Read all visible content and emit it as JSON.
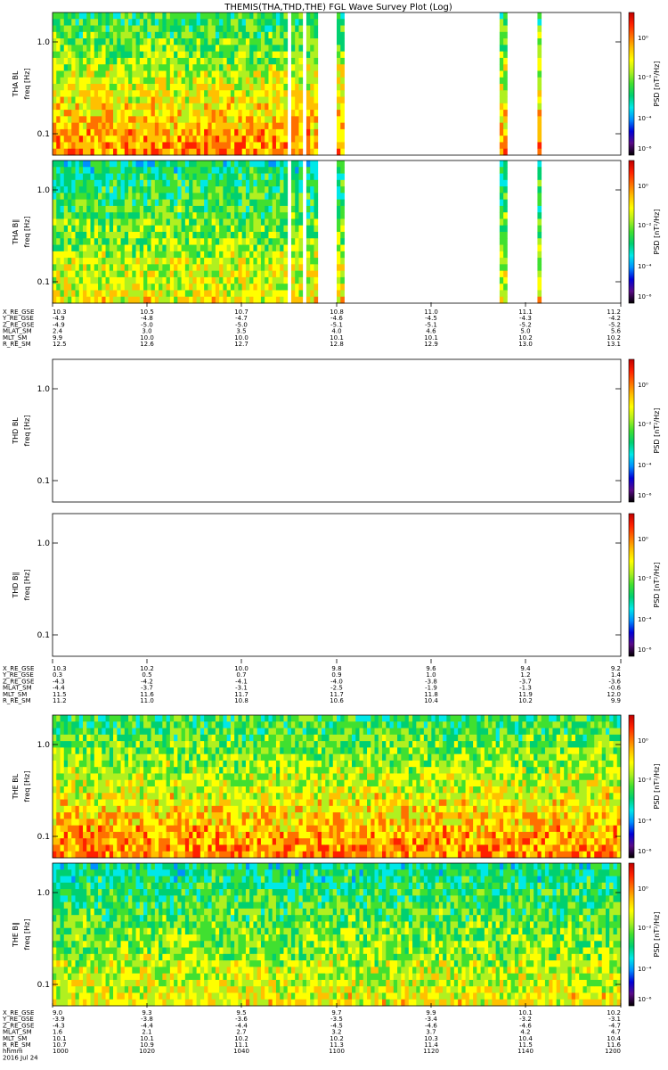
{
  "title": "THEMIS(THA,THD,THE) FGL Wave Survey Plot (Log)",
  "colors": {
    "colorbar_stops": [
      "#000000",
      "#5a0a86",
      "#0000d8",
      "#0090ff",
      "#00e8e8",
      "#00d070",
      "#40e030",
      "#b0f020",
      "#ffff00",
      "#ffc000",
      "#ff7000",
      "#ff2000",
      "#c00000"
    ]
  },
  "chart_data": [
    {
      "type": "heatmap",
      "probe": "THA",
      "component": "BL",
      "ylabel_line1": "THA BL",
      "ylabel_line2": "freq [Hz]",
      "cbar_label": "PSD [nT²/Hz]",
      "y_ticks": [
        "1.0",
        "0.1"
      ],
      "y_scale": "log",
      "cbar_ticks": [
        "10⁰",
        "10⁻²",
        "10⁻⁴",
        "10⁻⁶"
      ],
      "data_segments": [
        [
          0,
          0.387
        ],
        [
          0.399,
          0.413
        ],
        [
          0.42,
          0.435
        ],
        [
          0.452,
          0.459
        ],
        [
          0.46,
          0.465
        ],
        [
          0.503,
          0.507
        ],
        [
          0.79,
          0.795
        ],
        [
          0.857,
          0.86
        ],
        [
          1.02,
          1.022
        ],
        [
          1.034,
          1.04
        ],
        [
          1.077,
          1.08
        ],
        [
          1.116,
          1.125
        ],
        [
          1.128,
          1.133
        ],
        [
          1.143,
          1.147
        ]
      ],
      "level_profile": "high"
    },
    {
      "type": "heatmap",
      "probe": "THA",
      "component": "B∥",
      "ylabel_line1": "THA B∥",
      "ylabel_line2": "freq [Hz]",
      "cbar_label": "PSD [nT²/Hz]",
      "y_ticks": [
        "1.0",
        "0.1"
      ],
      "y_scale": "log",
      "cbar_ticks": [
        "10⁰",
        "10⁻²",
        "10⁻⁴",
        "10⁻⁶"
      ],
      "data_segments": [
        [
          0,
          0.387
        ],
        [
          0.399,
          0.413
        ],
        [
          0.42,
          0.435
        ],
        [
          0.452,
          0.459
        ],
        [
          0.46,
          0.465
        ],
        [
          0.503,
          0.507
        ],
        [
          0.79,
          0.795
        ],
        [
          0.857,
          0.86
        ],
        [
          1.02,
          1.022
        ],
        [
          1.034,
          1.04
        ],
        [
          1.077,
          1.08
        ],
        [
          1.116,
          1.125
        ],
        [
          1.128,
          1.133
        ],
        [
          1.143,
          1.147
        ]
      ],
      "level_profile": "mid"
    },
    {
      "type": "heatmap",
      "probe": "THD",
      "component": "BL",
      "ylabel_line1": "THD BL",
      "ylabel_line2": "freq [Hz]",
      "cbar_label": "PSD [nT²/Hz]",
      "y_ticks": [
        "1.0",
        "0.1"
      ],
      "y_scale": "log",
      "cbar_ticks": [
        "10⁰",
        "10⁻²",
        "10⁻⁴",
        "10⁻⁶"
      ],
      "data_segments": [],
      "level_profile": "none"
    },
    {
      "type": "heatmap",
      "probe": "THD",
      "component": "B∥",
      "ylabel_line1": "THD B∥",
      "ylabel_line2": "freq [Hz]",
      "cbar_label": "PSD [nT²/Hz]",
      "y_ticks": [
        "1.0",
        "0.1"
      ],
      "y_scale": "log",
      "cbar_ticks": [
        "10⁰",
        "10⁻²",
        "10⁻⁴",
        "10⁻⁶"
      ],
      "data_segments": [],
      "level_profile": "none"
    },
    {
      "type": "heatmap",
      "probe": "THE",
      "component": "BL",
      "ylabel_line1": "THE BL",
      "ylabel_line2": "freq [Hz]",
      "cbar_label": "PSD [nT²/Hz]",
      "y_ticks": [
        "1.0",
        "0.1"
      ],
      "y_scale": "log",
      "cbar_ticks": [
        "10⁰",
        "10⁻²",
        "10⁻⁴",
        "10⁻⁶"
      ],
      "data_segments": [
        [
          0,
          1
        ]
      ],
      "level_profile": "high"
    },
    {
      "type": "heatmap",
      "probe": "THE",
      "component": "B∥",
      "ylabel_line1": "THE B∥",
      "ylabel_line2": "freq [Hz]",
      "cbar_label": "PSD [nT²/Hz]",
      "y_ticks": [
        "1.0",
        "0.1"
      ],
      "y_scale": "log",
      "cbar_ticks": [
        "10⁰",
        "10⁻²",
        "10⁻⁴",
        "10⁻⁶"
      ],
      "data_segments": [
        [
          0,
          1
        ]
      ],
      "level_profile": "mid"
    }
  ],
  "ephemeris": [
    {
      "probe": "THA",
      "labels": [
        "X_RE_GSE",
        "Y_RE_GSE",
        "Z_RE_GSE",
        "MLAT_SM",
        "MLT_SM",
        "R_RE_SM"
      ],
      "rows": [
        [
          "10.3",
          "10.5",
          "10.7",
          "10.8",
          "11.0",
          "11.1",
          "11.2"
        ],
        [
          "-4.9",
          "-4.8",
          "-4.7",
          "-4.6",
          "-4.5",
          "-4.3",
          "-4.2"
        ],
        [
          "-4.9",
          "-5.0",
          "-5.0",
          "-5.1",
          "-5.1",
          "-5.2",
          "-5.2"
        ],
        [
          "2.4",
          "3.0",
          "3.5",
          "4.0",
          "4.6",
          "5.0",
          "5.6"
        ],
        [
          "9.9",
          "10.0",
          "10.0",
          "10.1",
          "10.1",
          "10.2",
          "10.2"
        ],
        [
          "12.5",
          "12.6",
          "12.7",
          "12.8",
          "12.9",
          "13.0",
          "13.1"
        ]
      ]
    },
    {
      "probe": "THD",
      "labels": [
        "X_RE_GSE",
        "Y_RE_GSE",
        "Z_RE_GSE",
        "MLAT_SM",
        "MLT_SM",
        "R_RE_SM"
      ],
      "rows": [
        [
          "10.3",
          "10.2",
          "10.0",
          "9.8",
          "9.6",
          "9.4",
          "9.2"
        ],
        [
          "0.3",
          "0.5",
          "0.7",
          "0.9",
          "1.0",
          "1.2",
          "1.4"
        ],
        [
          "-4.3",
          "-4.2",
          "-4.1",
          "-4.0",
          "-3.8",
          "-3.7",
          "-3.6"
        ],
        [
          "-4.4",
          "-3.7",
          "-3.1",
          "-2.5",
          "-1.9",
          "-1.3",
          "-0.6"
        ],
        [
          "11.5",
          "11.6",
          "11.7",
          "11.7",
          "11.8",
          "11.9",
          "12.0"
        ],
        [
          "11.2",
          "11.0",
          "10.8",
          "10.6",
          "10.4",
          "10.2",
          "9.9"
        ]
      ]
    },
    {
      "probe": "THE",
      "labels": [
        "X_RE_GSE",
        "Y_RE_GSE",
        "Z_RE_GSE",
        "MLAT_SM",
        "MLT_SM",
        "R_RE_SM",
        "hhmm",
        "2016 Jul 24"
      ],
      "rows": [
        [
          "9.0",
          "9.3",
          "9.5",
          "9.7",
          "9.9",
          "10.1",
          "10.2"
        ],
        [
          "-3.9",
          "-3.8",
          "-3.6",
          "-3.5",
          "-3.4",
          "-3.2",
          "-3.1"
        ],
        [
          "-4.3",
          "-4.4",
          "-4.4",
          "-4.5",
          "-4.6",
          "-4.6",
          "-4.7"
        ],
        [
          "1.6",
          "2.1",
          "2.7",
          "3.2",
          "3.7",
          "4.2",
          "4.7"
        ],
        [
          "10.1",
          "10.1",
          "10.2",
          "10.2",
          "10.3",
          "10.4",
          "10.4"
        ],
        [
          "10.7",
          "10.9",
          "11.1",
          "11.3",
          "11.4",
          "11.5",
          "11.6"
        ],
        [
          "1000",
          "1020",
          "1040",
          "1100",
          "1120",
          "1140",
          "1200"
        ]
      ]
    }
  ]
}
